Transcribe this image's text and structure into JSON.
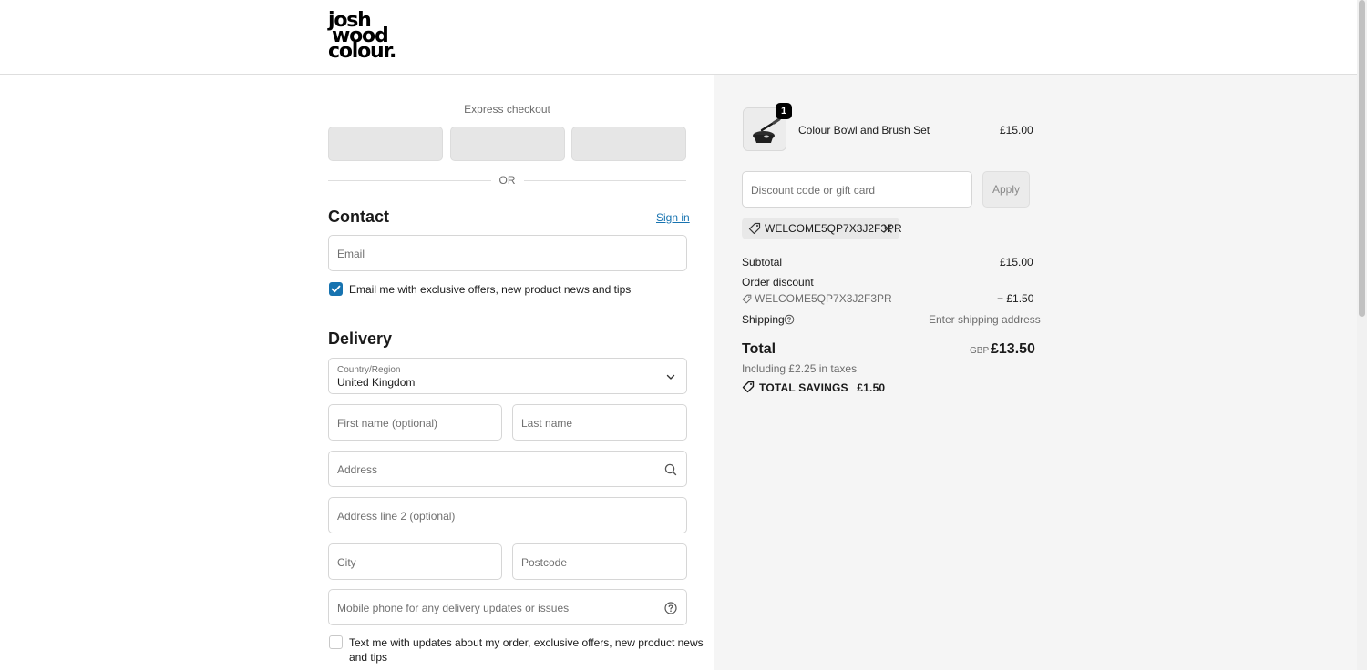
{
  "brand": {
    "logo_line1": "josh",
    "logo_line2": "wood",
    "logo_line3": "colour."
  },
  "express": {
    "title": "Express checkout",
    "separator": "OR"
  },
  "contact": {
    "title": "Contact",
    "sign_in": "Sign in",
    "email_placeholder": "Email",
    "marketing_label": "Email me with exclusive offers, new product news and tips",
    "marketing_checked": true
  },
  "delivery": {
    "title": "Delivery",
    "country_label": "Country/Region",
    "country_value": "United Kingdom",
    "first_name_placeholder": "First name (optional)",
    "last_name_placeholder": "Last name",
    "address_placeholder": "Address",
    "address2_placeholder": "Address line 2 (optional)",
    "city_placeholder": "City",
    "postcode_placeholder": "Postcode",
    "phone_placeholder": "Mobile phone for any delivery updates or issues",
    "sms_label_line1": "Text me with updates about my order, exclusive offers, new product news",
    "sms_label_line2": "and tips",
    "sms_checked": false
  },
  "summary": {
    "item": {
      "quantity": "1",
      "name": "Colour Bowl and Brush Set",
      "price": "£15.00"
    },
    "discount_placeholder": "Discount code or gift card",
    "apply_label": "Apply",
    "applied_code": "WELCOME5QP7X3J2F3PR",
    "subtotal_label": "Subtotal",
    "subtotal_value": "£15.00",
    "order_discount_label": "Order discount",
    "order_discount_code": "WELCOME5QP7X3J2F3PR",
    "order_discount_value": "− £1.50",
    "shipping_label": "Shipping",
    "shipping_value": "Enter shipping address",
    "total_label": "Total",
    "total_currency": "GBP",
    "total_value": "£13.50",
    "taxes_note": "Including £2.25 in taxes",
    "savings_label": "TOTAL SAVINGS",
    "savings_value": "£1.50"
  },
  "colors": {
    "link": "#1773b0",
    "checkbox_on": "#1773b0",
    "summary_bg": "#f5f5f5"
  },
  "icons": [
    "search-icon",
    "help-circle-icon",
    "chevron-down-icon",
    "tag-icon",
    "close-icon",
    "check-icon"
  ]
}
